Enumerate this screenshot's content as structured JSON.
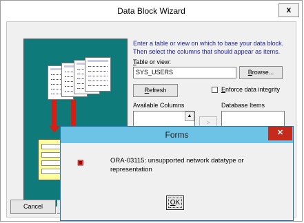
{
  "wizard": {
    "title": "Data Block Wizard",
    "close_label": "x",
    "instruction_line1": "Enter a table or view on which to base your data block.",
    "instruction_line2": "Then select the columns that should appear as items.",
    "table_label_first": "T",
    "table_label_rest": "able or view:",
    "table_value": "SYS_USERS",
    "browse_label_first": "B",
    "browse_label_rest": "rowse...",
    "refresh_label_first": "R",
    "refresh_label_rest": "efresh",
    "enforce_label_first": "E",
    "enforce_label_rest": "nforce data integrity",
    "enforce_checked": false,
    "available_columns_label": "Available Columns",
    "database_items_label": "Database Items",
    "move_button_label": ">",
    "cancel_label": "Cancel"
  },
  "dialog": {
    "title": "Forms",
    "close_label": "✕",
    "icon": "error-icon",
    "message": "ORA-03115: unsupported network datatype or representation",
    "ok_label_first": "O",
    "ok_label_rest": "K"
  },
  "colors": {
    "illustration_bg": "#0f7a7a",
    "arrow": "#d61e14",
    "instruction_text": "#1a1a9e",
    "dialog_titlebar": "#6cc3e6",
    "close_red": "#c42b1c"
  }
}
